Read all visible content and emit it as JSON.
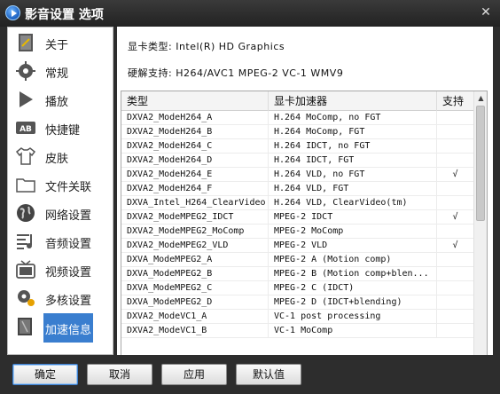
{
  "window": {
    "title": "影音设置 选项",
    "close_symbol": "✕"
  },
  "sidebar": {
    "items": [
      {
        "label": "关于",
        "icon": "about-icon"
      },
      {
        "label": "常规",
        "icon": "gear-icon"
      },
      {
        "label": "播放",
        "icon": "play-icon"
      },
      {
        "label": "快捷键",
        "icon": "keyboard-icon"
      },
      {
        "label": "皮肤",
        "icon": "shirt-icon"
      },
      {
        "label": "文件关联",
        "icon": "folder-icon"
      },
      {
        "label": "网络设置",
        "icon": "globe-icon"
      },
      {
        "label": "音频设置",
        "icon": "audio-icon"
      },
      {
        "label": "视频设置",
        "icon": "tv-icon"
      },
      {
        "label": "多核设置",
        "icon": "cpu-icon"
      },
      {
        "label": "加速信息",
        "icon": "accel-icon",
        "active": true
      }
    ]
  },
  "info": {
    "gpu_line": "显卡类型: Intel(R) HD Graphics",
    "hw_line": "硬解支持: H264/AVC1  MPEG-2  VC-1  WMV9"
  },
  "table": {
    "headers": [
      "类型",
      "显卡加速器",
      "支持"
    ],
    "rows": [
      [
        "DXVA2_ModeH264_A",
        "H.264 MoComp, no FGT",
        ""
      ],
      [
        "DXVA2_ModeH264_B",
        "H.264 MoComp, FGT",
        ""
      ],
      [
        "DXVA2_ModeH264_C",
        "H.264 IDCT, no FGT",
        ""
      ],
      [
        "DXVA2_ModeH264_D",
        "H.264 IDCT, FGT",
        ""
      ],
      [
        "DXVA2_ModeH264_E",
        "H.264 VLD, no FGT",
        "√"
      ],
      [
        "DXVA2_ModeH264_F",
        "H.264 VLD, FGT",
        ""
      ],
      [
        "DXVA_Intel_H264_ClearVideo",
        "H.264 VLD, ClearVideo(tm)",
        ""
      ],
      [
        "DXVA2_ModeMPEG2_IDCT",
        "MPEG-2 IDCT",
        "√"
      ],
      [
        "DXVA2_ModeMPEG2_MoComp",
        "MPEG-2 MoComp",
        ""
      ],
      [
        "DXVA2_ModeMPEG2_VLD",
        "MPEG-2 VLD",
        "√"
      ],
      [
        "DXVA_ModeMPEG2_A",
        "MPEG-2 A (Motion comp)",
        ""
      ],
      [
        "DXVA_ModeMPEG2_B",
        "MPEG-2 B (Motion comp+blen...",
        ""
      ],
      [
        "DXVA_ModeMPEG2_C",
        "MPEG-2 C (IDCT)",
        ""
      ],
      [
        "DXVA_ModeMPEG2_D",
        "MPEG-2 D (IDCT+blending)",
        ""
      ],
      [
        "DXVA2_ModeVC1_A",
        "VC-1 post processing",
        ""
      ],
      [
        "DXVA2_ModeVC1_B",
        "VC-1 MoComp",
        ""
      ]
    ]
  },
  "buttons": {
    "ok": "确定",
    "cancel": "取消",
    "apply": "应用",
    "default": "默认值"
  },
  "colors": {
    "accent": "#3a7ecf",
    "window_bg": "#2d2d2d"
  }
}
